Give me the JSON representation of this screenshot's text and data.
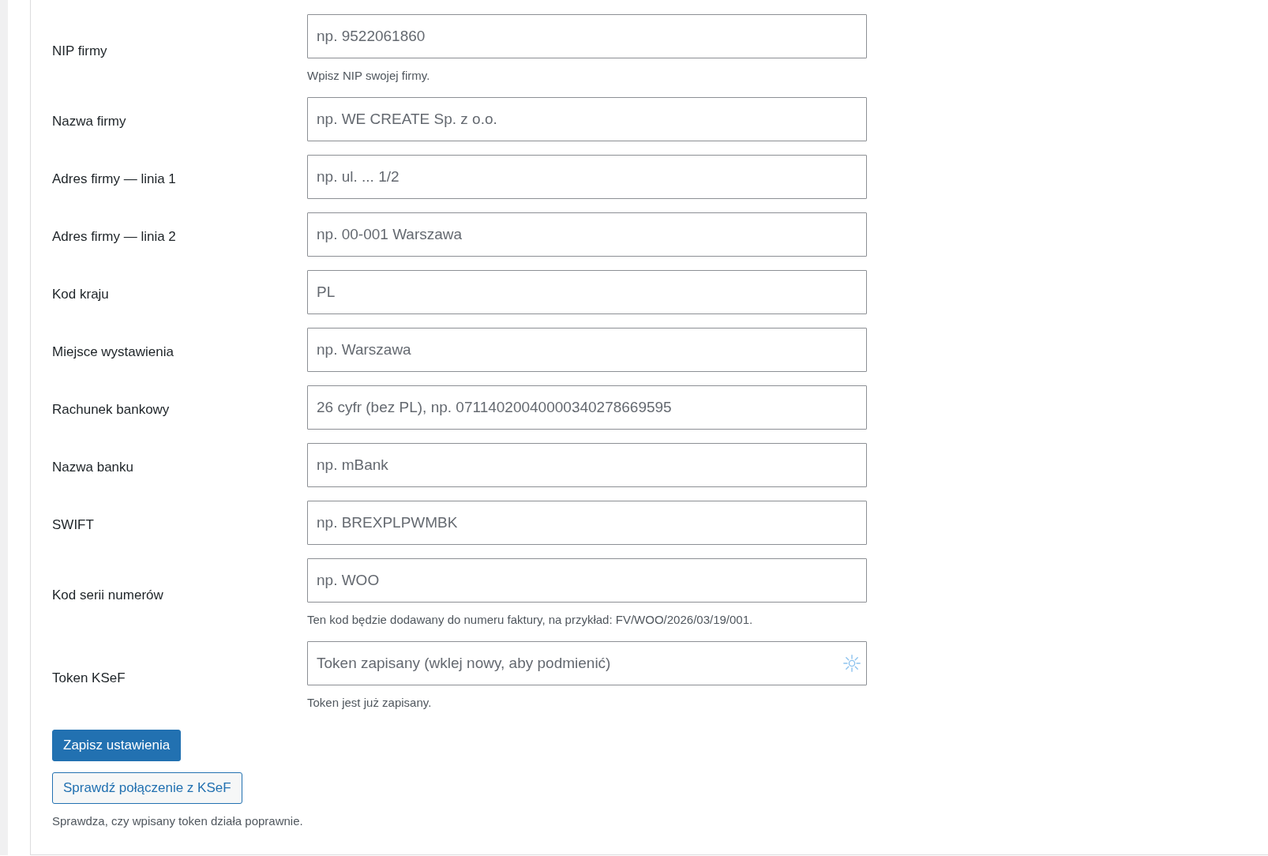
{
  "fields": [
    {
      "label": "NIP firmy",
      "kind": "text",
      "placeholder": "np. 9522061860",
      "description": "Wpisz NIP swojej firmy."
    },
    {
      "label": "Nazwa firmy",
      "kind": "text",
      "placeholder": "np. WE CREATE Sp. z o.o."
    },
    {
      "label": "Adres firmy — linia 1",
      "kind": "text",
      "placeholder": "np. ul. ... 1/2"
    },
    {
      "label": "Adres firmy — linia 2",
      "kind": "text",
      "placeholder": "np. 00-001 Warszawa"
    },
    {
      "label": "Kod kraju",
      "kind": "text",
      "placeholder": "PL"
    },
    {
      "label": "Miejsce wystawienia",
      "kind": "text",
      "placeholder": "np. Warszawa"
    },
    {
      "label": "Rachunek bankowy",
      "kind": "text",
      "placeholder": "26 cyfr (bez PL), np. 07114020040000340278669595"
    },
    {
      "label": "Nazwa banku",
      "kind": "text",
      "placeholder": "np. mBank"
    },
    {
      "label": "SWIFT",
      "kind": "text",
      "placeholder": "np. BREXPLPWMBK"
    },
    {
      "label": "Kod serii numerów",
      "kind": "text",
      "placeholder": "np. WOO",
      "description": "Ten kod będzie dodawany do numeru faktury, na przykład: FV/WOO/2026/03/19/001."
    },
    {
      "label": "Token KSeF",
      "kind": "password",
      "placeholder": "Token zapisany (wklej nowy, aby podmienić)",
      "description": "Token jest już zapisany."
    }
  ],
  "buttons": [
    {
      "label": "Zapisz ustawienia",
      "kind": "primary"
    },
    {
      "label": "Sprawdź połączenie z KSeF",
      "kind": "secondary"
    }
  ],
  "help_text": "Sprawdza, czy wpisany token działa poprawnie."
}
